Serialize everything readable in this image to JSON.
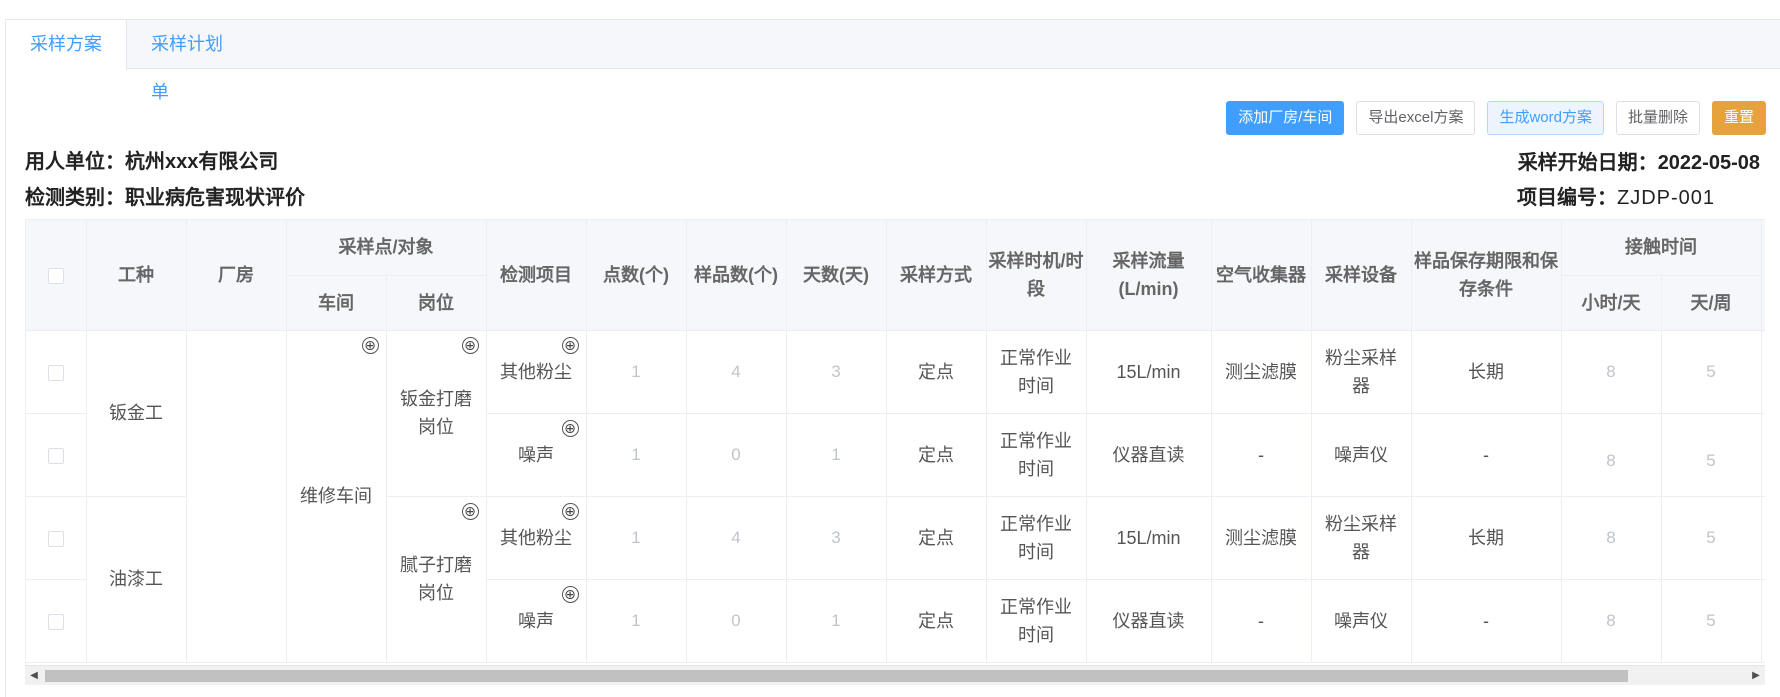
{
  "tabs": [
    {
      "label": "采样方案",
      "active": true
    },
    {
      "label": "采样计划单",
      "active": false
    }
  ],
  "toolbar": {
    "add": "添加厂房/车间",
    "export_excel": "导出excel方案",
    "gen_word": "生成word方案",
    "batch_delete": "批量删除",
    "reset": "重置"
  },
  "info": {
    "employer_label": "用人单位：",
    "employer_value": "杭州xxx有限公司",
    "type_label": "检测类别：",
    "type_value": "职业病危害现状评价",
    "start_label": "采样开始日期：",
    "start_value": "2022-05-08",
    "code_label": "项目编号：",
    "code_value": "ZJDP-001"
  },
  "table": {
    "headers": {
      "job": "工种",
      "plant": "厂房",
      "point_group": "采样点/对象",
      "workshop": "车间",
      "post": "岗位",
      "item": "检测项目",
      "points": "点数(个)",
      "samples": "样品数(个)",
      "days": "天数(天)",
      "method": "采样方式",
      "timing": "采样时机/时段",
      "flow": "采样流量(L/min)",
      "collector": "空气收集器",
      "equipment": "采样设备",
      "storage": "样品保存期限和保存条件",
      "contact_group": "接触时间",
      "hours_day": "小时/天",
      "days_week": "天/周"
    },
    "groups": [
      {
        "job": "钣金工",
        "post": "钣金打磨岗位"
      },
      {
        "job": "油漆工",
        "post": "腻子打磨岗位"
      }
    ],
    "workshop": "维修车间",
    "plant": "",
    "rows": [
      {
        "item": "其他粉尘",
        "points": "1",
        "samples": "4",
        "days": "3",
        "method": "定点",
        "timing": "正常作业时间",
        "flow": "15L/min",
        "collector": "测尘滤膜",
        "equipment": "粉尘采样器",
        "storage": "长期",
        "hours": "8",
        "week": "5"
      },
      {
        "item": "噪声",
        "points": "1",
        "samples": "0",
        "days": "1",
        "method": "定点",
        "timing": "正常作业时间",
        "flow": "仪器直读",
        "collector": "-",
        "equipment": "噪声仪",
        "storage": "-",
        "hours": "8",
        "week": "5"
      },
      {
        "item": "其他粉尘",
        "points": "1",
        "samples": "4",
        "days": "3",
        "method": "定点",
        "timing": "正常作业时间",
        "flow": "15L/min",
        "collector": "测尘滤膜",
        "equipment": "粉尘采样器",
        "storage": "长期",
        "hours": "8",
        "week": "5"
      },
      {
        "item": "噪声",
        "points": "1",
        "samples": "0",
        "days": "1",
        "method": "定点",
        "timing": "正常作业时间",
        "flow": "仪器直读",
        "collector": "-",
        "equipment": "噪声仪",
        "storage": "-",
        "hours": "8",
        "week": "5"
      }
    ]
  },
  "icons": {
    "add_icon": "⊕"
  }
}
